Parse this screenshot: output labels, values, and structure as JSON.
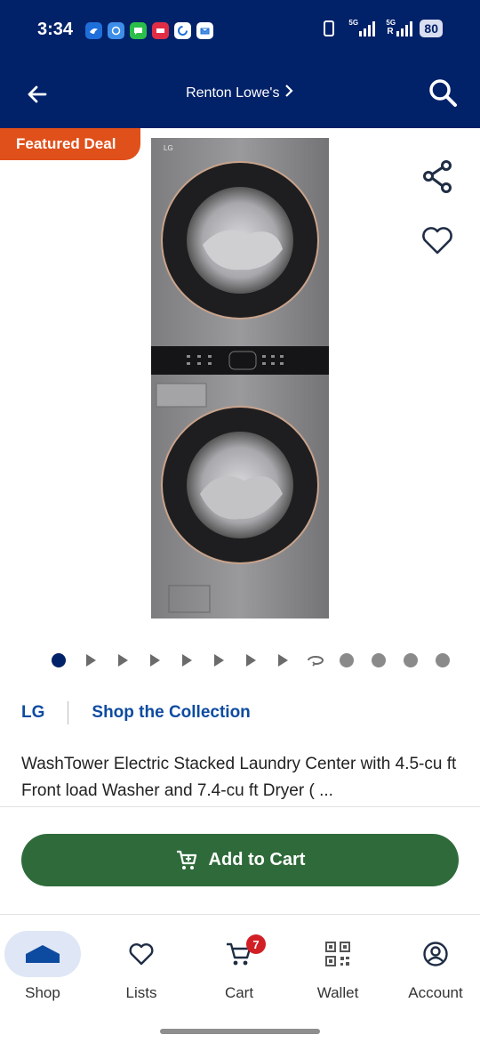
{
  "status_bar": {
    "time": "3:34",
    "network_1": "5G",
    "network_2": "5G",
    "roaming": "R",
    "battery": "80"
  },
  "nav": {
    "store": "Renton Lowe's"
  },
  "product": {
    "badge": "Featured Deal",
    "brand": "LG",
    "collection_link": "Shop the Collection",
    "title": "WashTower Electric Stacked Laundry Center with 4.5-cu ft Front load Washer and 7.4-cu ft Dryer ( ...",
    "image_logo": "LG"
  },
  "add_to_cart": {
    "label": "Add to Cart"
  },
  "bottom_nav": {
    "tabs": [
      {
        "label": "Shop",
        "icon": "house-icon",
        "active": true
      },
      {
        "label": "Lists",
        "icon": "heart-icon"
      },
      {
        "label": "Cart",
        "icon": "cart-icon",
        "badge": "7"
      },
      {
        "label": "Wallet",
        "icon": "qr-code-icon"
      },
      {
        "label": "Account",
        "icon": "account-icon"
      }
    ]
  },
  "colors": {
    "header_bg": "#012169",
    "badge_bg": "#e0501b",
    "link_blue": "#0d4ba0",
    "cart_button": "#2f6b3a",
    "cart_badge": "#d21f26"
  }
}
